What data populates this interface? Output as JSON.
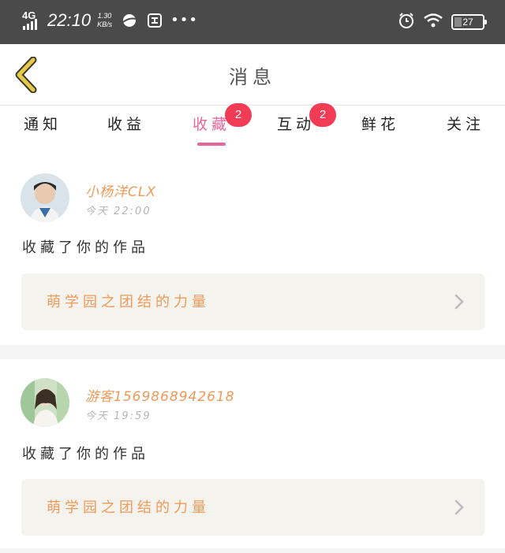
{
  "status_bar": {
    "network": "4G",
    "time": "22:10",
    "speed_value": "1.30",
    "speed_unit": "KB/s",
    "battery": "27",
    "icons": [
      "signal-icon",
      "browser-icon",
      "app-icon",
      "more-dots-icon",
      "alarm-icon",
      "wifi-icon",
      "battery-icon"
    ]
  },
  "header": {
    "title": "消息",
    "back_icon": "chevron-left-icon"
  },
  "tabs": [
    {
      "label": "通知"
    },
    {
      "label": "收益"
    },
    {
      "label": "收藏",
      "badge": "2",
      "active": true
    },
    {
      "label": "互动",
      "badge": "2"
    },
    {
      "label": "鲜花"
    },
    {
      "label": "关注"
    }
  ],
  "messages": [
    {
      "username": "小杨洋CLX",
      "time": "今天 22:00",
      "action": "收藏了你的作品",
      "work_title": "萌学园之团结的力量"
    },
    {
      "username": "游客1569868942618",
      "time": "今天 19:59",
      "action": "收藏了你的作品",
      "work_title": "萌学园之团结的力量"
    }
  ],
  "colors": {
    "accent": "#e8659a",
    "badge": "#f23b55",
    "name": "#ef9a5a",
    "status_bar": "#4a4a4a",
    "back_arrow": "#e6c84a"
  }
}
